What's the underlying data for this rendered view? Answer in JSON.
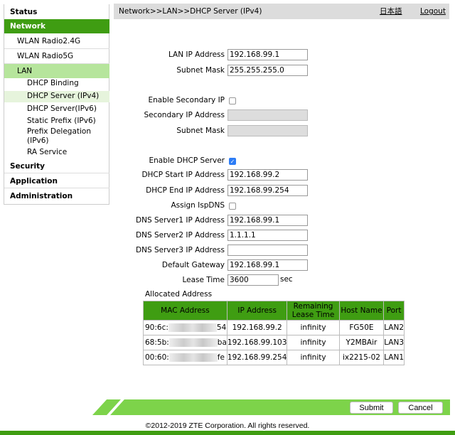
{
  "sidebar": {
    "items": [
      {
        "label": "Status"
      },
      {
        "label": "Network"
      },
      {
        "label": "WLAN Radio2.4G"
      },
      {
        "label": "WLAN Radio5G"
      },
      {
        "label": "LAN"
      },
      {
        "label": "DHCP Binding"
      },
      {
        "label": "DHCP Server (IPv4)"
      },
      {
        "label": "DHCP Server(IPv6)"
      },
      {
        "label": "Static Prefix (IPv6)"
      },
      {
        "label": "Prefix Delegation (IPv6)"
      },
      {
        "label": "RA Service"
      },
      {
        "label": "Security"
      },
      {
        "label": "Application"
      },
      {
        "label": "Administration"
      }
    ]
  },
  "header": {
    "breadcrumb": "Network>>LAN>>DHCP Server (IPv4)",
    "language": "日本語",
    "logout": "Logout"
  },
  "form": {
    "lan_ip_label": "LAN IP Address",
    "lan_ip": "192.168.99.1",
    "subnet_label": "Subnet Mask",
    "subnet": "255.255.255.0",
    "enable_secondary_label": "Enable Secondary IP",
    "enable_secondary": false,
    "secondary_ip_label": "Secondary IP Address",
    "secondary_ip": "",
    "secondary_subnet_label": "Subnet Mask",
    "secondary_subnet": "",
    "enable_dhcp_label": "Enable DHCP Server",
    "enable_dhcp": true,
    "start_label": "DHCP Start IP Address",
    "start": "192.168.99.2",
    "end_label": "DHCP End IP Address",
    "end": "192.168.99.254",
    "isp_dns_label": "Assign IspDNS",
    "isp_dns": false,
    "dns1_label": "DNS Server1 IP Address",
    "dns1": "192.168.99.1",
    "dns2_label": "DNS Server2 IP Address",
    "dns2": "1.1.1.1",
    "dns3_label": "DNS Server3 IP Address",
    "dns3": "",
    "gateway_label": "Default Gateway",
    "gateway": "192.168.99.1",
    "lease_label": "Lease Time",
    "lease": "3600",
    "lease_unit": "sec"
  },
  "allocated": {
    "title": "Allocated Address",
    "headers": [
      "MAC Address",
      "IP Address",
      "Remaining Lease Time",
      "Host Name",
      "Port"
    ],
    "rows": [
      {
        "mac_prefix": "90:6c:",
        "mac_suffix": "54",
        "ip": "192.168.99.2",
        "lease": "infinity",
        "host": "FG50E",
        "port": "LAN2"
      },
      {
        "mac_prefix": "68:5b:",
        "mac_suffix": "ba",
        "ip": "192.168.99.103",
        "lease": "infinity",
        "host": "Y2MBAir",
        "port": "LAN3"
      },
      {
        "mac_prefix": "00:60:",
        "mac_suffix": "fe",
        "ip": "192.168.99.254",
        "lease": "infinity",
        "host": "ix2215-02",
        "port": "LAN1"
      }
    ]
  },
  "footer": {
    "submit": "Submit",
    "cancel": "Cancel",
    "copyright": "©2012-2019 ZTE Corporation. All rights reserved."
  },
  "colors": {
    "primary_green": "#3f9d12",
    "light_green": "#b6e59c",
    "band_green": "#7dd34a"
  }
}
